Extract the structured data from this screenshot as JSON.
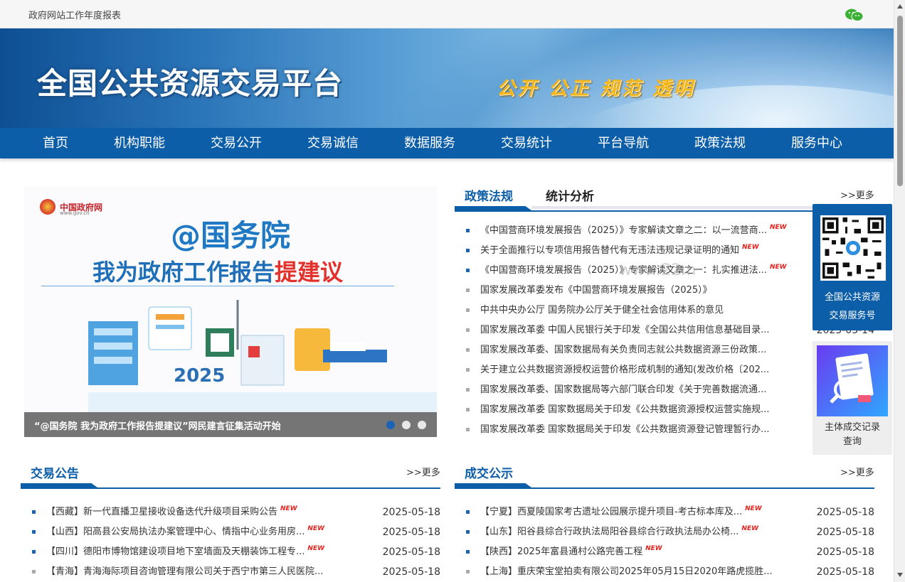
{
  "topbar": {
    "report_link": "政府网站工作年度报表",
    "wechat_icon": "wechat-icon"
  },
  "banner": {
    "title": "全国公共资源交易平台",
    "slogan": "公开 公正 规范 透明"
  },
  "nav": {
    "items": [
      "首页",
      "机构职能",
      "交易公开",
      "交易诚信",
      "数据服务",
      "交易统计",
      "平台导航",
      "政策法规",
      "服务中心"
    ]
  },
  "carousel": {
    "site_name": "中国政府网",
    "site_url": "www.gov.cn",
    "headline1": "@国务院",
    "headline2_main": "我为政府工作报告",
    "headline2_red": "提建议",
    "year": "2025",
    "caption": "“@国务院 我为政府工作报告提建议”网民建言征集活动开始",
    "active_dot": 0
  },
  "policy": {
    "tab_active": "政策法规",
    "tab_other": "统计分析",
    "more": ">>更多",
    "new_label": "NEW",
    "items": [
      {
        "text": "《中国营商环境发展报告（2025）》专家解读文章之二：以一流营商...",
        "new": true,
        "date": "",
        "bullet": "blue"
      },
      {
        "text": "关于全面推行以专项信用报告替代有无违法违规记录证明的通知",
        "new": true,
        "date": "",
        "bullet": "blue"
      },
      {
        "text": "《中国营商环境发展报告（2025）》专家解读文章之一：扎实推进法...",
        "new": true,
        "date": "",
        "bullet": "blue"
      },
      {
        "text": "国家发展改革委发布《中国营商环境发展报告（2025）》",
        "new": false,
        "date": "",
        "bullet": "grey"
      },
      {
        "text": "中共中央办公厅 国务院办公厅关于健全社会信用体系的意见",
        "new": false,
        "date": "",
        "bullet": "grey"
      },
      {
        "text": "国家发展改革委 中国人民银行关于印发《全国公共信用信息基础目录...",
        "new": false,
        "date": "2025-03-14",
        "bullet": "grey"
      },
      {
        "text": "国家发展改革委、国家数据局有关负责同志就公共数据资源三份政策...",
        "new": false,
        "date": "",
        "bullet": "grey"
      },
      {
        "text": "关于建立公共数据资源授权运营价格形成机制的通知(发改价格〔202...",
        "new": false,
        "date": "",
        "bullet": "grey"
      },
      {
        "text": "国家发展改革委、国家数据局等六部门联合印发《关于完善数据流通...",
        "new": false,
        "date": "",
        "bullet": "grey"
      },
      {
        "text": "国家发展改革委 国家数据局关于印发《公共数据资源授权运营实施规...",
        "new": false,
        "date": "",
        "bullet": "grey"
      },
      {
        "text": "国家发展改革委 国家数据局关于印发《公共数据资源登记管理暂行办...",
        "new": false,
        "date": "",
        "bullet": "grey"
      }
    ]
  },
  "trade_notice": {
    "title": "交易公告",
    "more": ">>更多",
    "items": [
      {
        "text": "【西藏】新一代直播卫星接收设备迭代升级项目采购公告",
        "new": true,
        "date": "2025-05-18",
        "bullet": "blue"
      },
      {
        "text": "【山西】阳高县公安局执法办案管理中心、情指中心业务用房...",
        "new": true,
        "date": "2025-05-18",
        "bullet": "blue"
      },
      {
        "text": "【四川】德阳市博物馆建设项目地下室墙面及天棚装饰工程专...",
        "new": true,
        "date": "2025-05-18",
        "bullet": "blue"
      },
      {
        "text": "【青海】青海海际项目咨询管理有限公司关于西宁市第三人民医院...",
        "new": false,
        "date": "2025-05-18",
        "bullet": "grey"
      }
    ]
  },
  "deal_notice": {
    "title": "成交公示",
    "more": ">>更多",
    "items": [
      {
        "text": "【宁夏】西夏陵国家考古遗址公园展示提升项目-考古标本库及...",
        "new": true,
        "date": "2025-05-18",
        "bullet": "blue"
      },
      {
        "text": "【山东】阳谷县综合行政执法局阳谷县综合行政执法局办公椅...",
        "new": true,
        "date": "2025-05-18",
        "bullet": "blue"
      },
      {
        "text": "【陕西】2025年富县通村公路完善工程",
        "new": true,
        "date": "2025-05-18",
        "bullet": "blue"
      },
      {
        "text": "【上海】重庆荣宝堂拍卖有限公司2025年05月15日2020年路虎揽胜...",
        "new": false,
        "date": "2025-05-18",
        "bullet": "grey"
      }
    ]
  },
  "float": {
    "qr_line1": "全国公共资源",
    "qr_line2": "交易服务号",
    "record_line1": "主体成交记录",
    "record_line2": "查询"
  },
  "watermark": "www.22m"
}
